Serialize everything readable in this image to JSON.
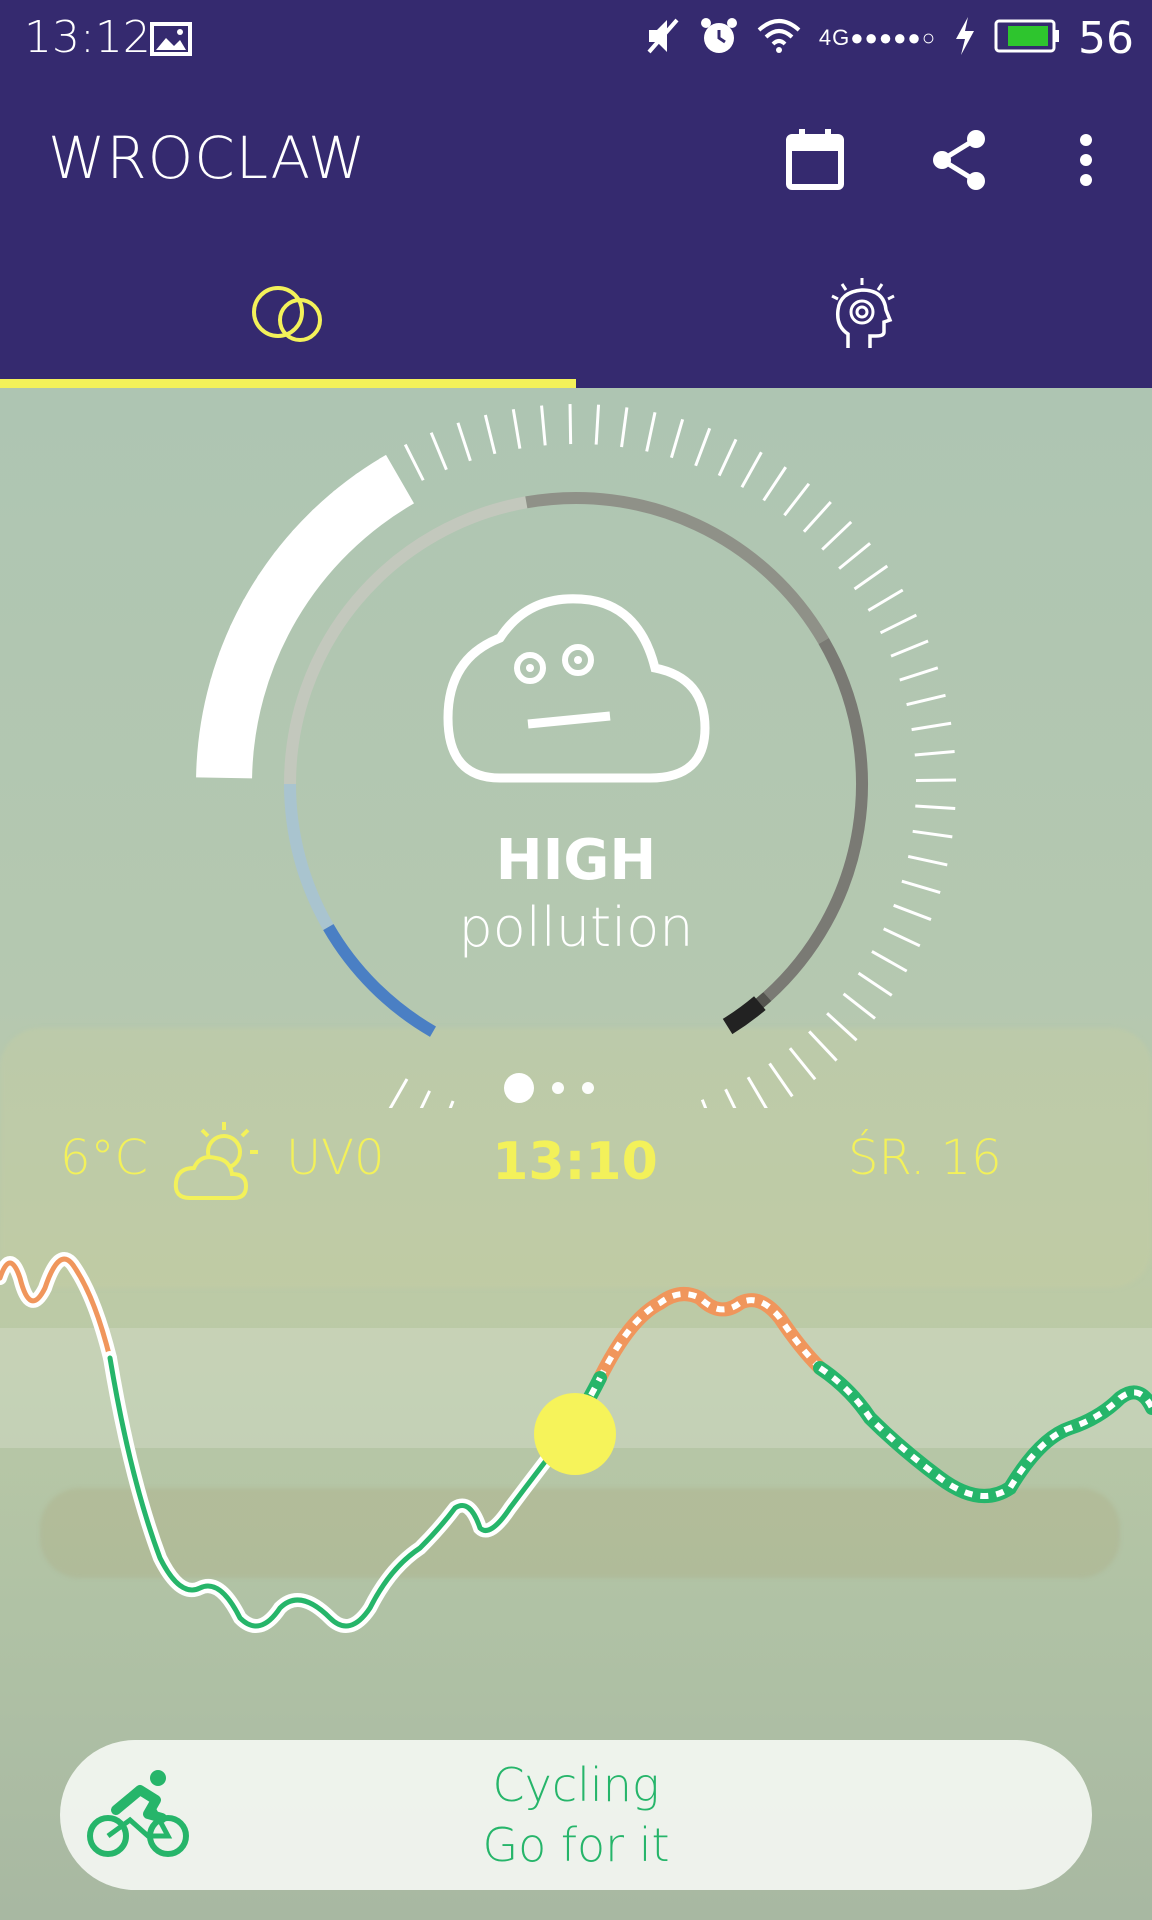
{
  "status_bar": {
    "time": "13:12",
    "network": "4G●●●●●○",
    "battery_percent": "56",
    "icons": [
      "image-icon",
      "mute-icon",
      "alarm-icon",
      "wifi-icon",
      "signal-icon",
      "charging-icon",
      "battery-icon"
    ]
  },
  "app_bar": {
    "title": "WROCLAW",
    "actions": [
      "calendar-icon",
      "share-icon",
      "more-vert-icon"
    ],
    "background": "#352a6f"
  },
  "tabs": [
    {
      "icon": "air-quality-icon",
      "selected": true
    },
    {
      "icon": "head-target-icon",
      "selected": false
    }
  ],
  "gauge": {
    "level": "HIGH",
    "subtitle": "pollution",
    "face_icon": "neutral-cloud-face-icon"
  },
  "pager": {
    "count": 3,
    "active": 0
  },
  "weather": {
    "temperature": "6°C",
    "icon": "partly-sunny-icon",
    "uv": "UV0",
    "time": "13:10",
    "date": "ŚR. 16"
  },
  "activity": {
    "icon": "cycling-icon",
    "title": "Cycling",
    "subtitle": "Go for it"
  },
  "colors": {
    "accent": "#f3f15a",
    "good": "#26b56a",
    "moderate": "#f0965c",
    "gauge_blue": "#4a7fc4",
    "gauge_dark": "#222222"
  }
}
